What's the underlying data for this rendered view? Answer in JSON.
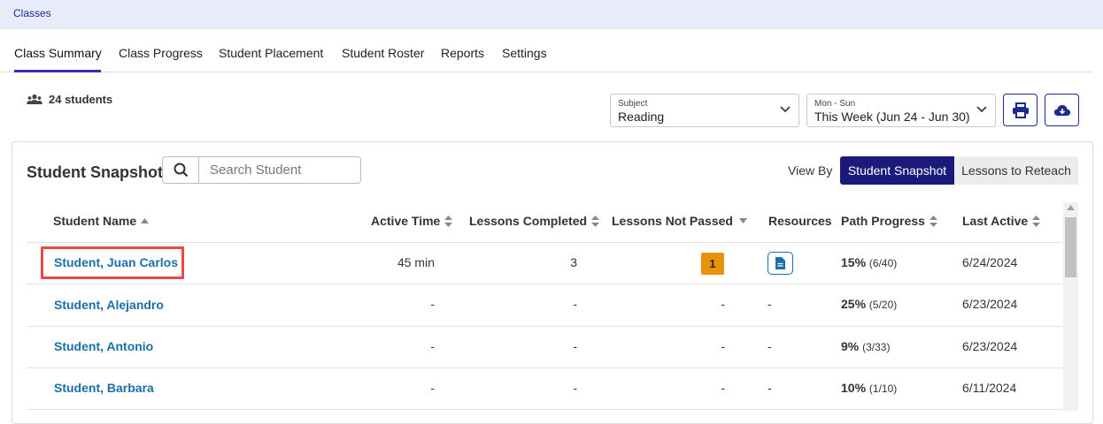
{
  "breadcrumb": {
    "label": "Classes"
  },
  "tabs": [
    {
      "label": "Class Summary",
      "active": true
    },
    {
      "label": "Class Progress"
    },
    {
      "label": "Student Placement"
    },
    {
      "label": "Student Roster"
    },
    {
      "label": "Reports"
    },
    {
      "label": "Settings"
    }
  ],
  "summary": {
    "student_count": "24 students"
  },
  "filters": {
    "subject": {
      "label": "Subject",
      "value": "Reading"
    },
    "week": {
      "label": "Mon - Sun",
      "value": "This Week (Jun 24 - Jun 30)"
    }
  },
  "actions": {
    "print_icon": "print-icon",
    "download_icon": "cloud-download-icon"
  },
  "snapshot": {
    "title": "Student Snapshot",
    "search_placeholder": "Search Student",
    "view_by_label": "View By",
    "view_options": [
      "Student Snapshot",
      "Lessons to Reteach"
    ],
    "active_view": "Student Snapshot"
  },
  "table": {
    "columns": [
      "Student Name",
      "Active Time",
      "Lessons Completed",
      "Lessons Not Passed",
      "Resources",
      "Path Progress",
      "Last Active"
    ],
    "rows": [
      {
        "name": "Student, Juan Carlos",
        "active_time": "45 min",
        "lessons_completed": "3",
        "lessons_not_passed": "1",
        "resources": "document-icon",
        "progress_pct": "15%",
        "progress_frac": "(6/40)",
        "last_active": "6/24/2024"
      },
      {
        "name": "Student, Alejandro",
        "active_time": "-",
        "lessons_completed": "-",
        "lessons_not_passed": "-",
        "resources": "-",
        "progress_pct": "25%",
        "progress_frac": "(5/20)",
        "last_active": "6/23/2024"
      },
      {
        "name": "Student, Antonio",
        "active_time": "-",
        "lessons_completed": "-",
        "lessons_not_passed": "-",
        "resources": "-",
        "progress_pct": "9%",
        "progress_frac": "(3/33)",
        "last_active": "6/23/2024"
      },
      {
        "name": "Student, Barbara",
        "active_time": "-",
        "lessons_completed": "-",
        "lessons_not_passed": "-",
        "resources": "-",
        "progress_pct": "10%",
        "progress_frac": "(1/10)",
        "last_active": "6/11/2024"
      }
    ]
  },
  "colors": {
    "accent": "#1a1a7c",
    "link": "#1b6fa8",
    "badge": "#e8920c",
    "highlight": "#e84a4a"
  }
}
